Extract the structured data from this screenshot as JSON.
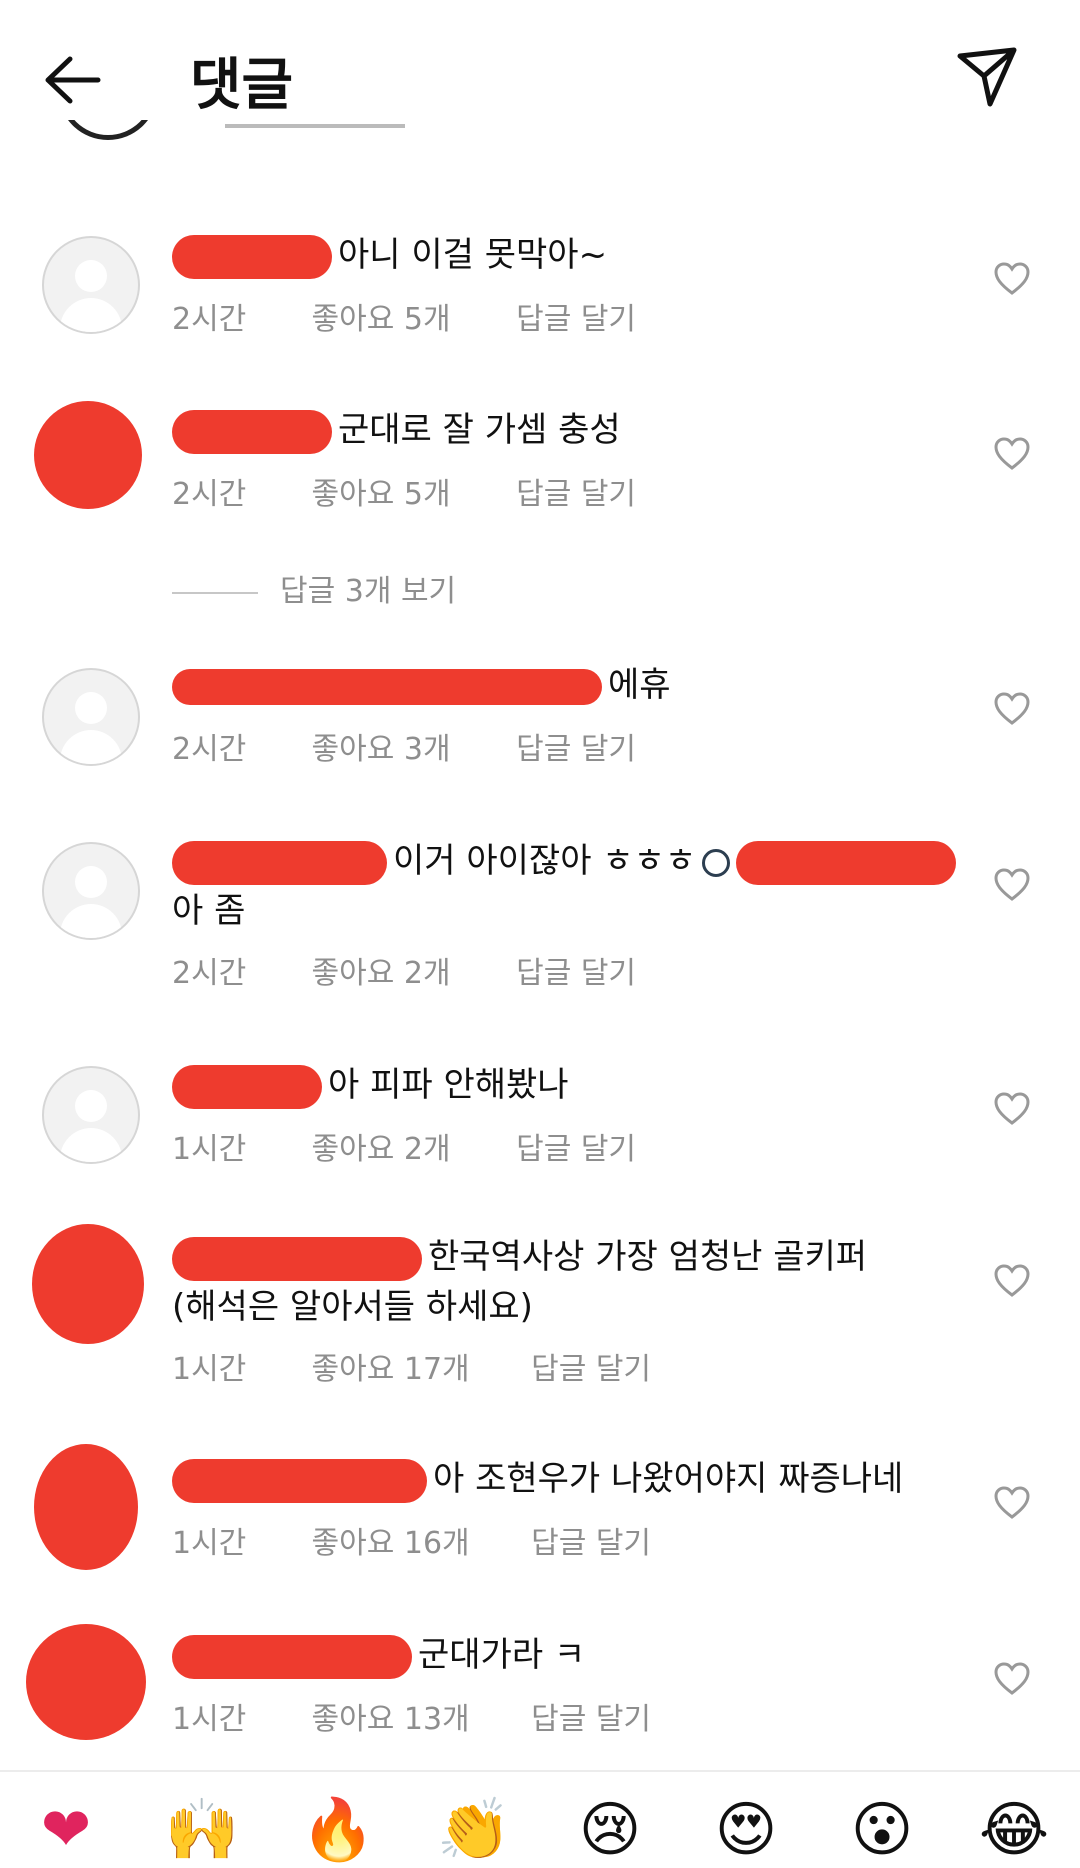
{
  "header": {
    "title": "댓글",
    "back_icon": "arrow-left-icon",
    "share_icon": "paper-plane-icon"
  },
  "comments": [
    {
      "text": "아니 이걸 못막아~",
      "time": "2시간",
      "likes": "좋아요 5개",
      "reply": "답글 달기"
    },
    {
      "text": "군대로 잘 가셈 충성",
      "time": "2시간",
      "likes": "좋아요 5개",
      "reply": "답글 달기"
    },
    {
      "text": "에휴",
      "time": "2시간",
      "likes": "좋아요 3개",
      "reply": "답글 달기"
    },
    {
      "text": "이거 아이잖아 ㅎㅎㅎ",
      "text2": "아 좀",
      "time": "2시간",
      "likes": "좋아요 2개",
      "reply": "답글 달기"
    },
    {
      "text": "아 피파 안해봤나",
      "time": "1시간",
      "likes": "좋아요 2개",
      "reply": "답글 달기"
    },
    {
      "text": "한국역사상 가장 엄청난 골키퍼",
      "text2": "(해석은 알아서들 하세요)",
      "time": "1시간",
      "likes": "좋아요 17개",
      "reply": "답글 달기"
    },
    {
      "text": "아 조현우가 나왔어야지 짜증나네",
      "time": "1시간",
      "likes": "좋아요 16개",
      "reply": "답글 달기"
    },
    {
      "text": "군대가라 ㅋ",
      "time": "1시간",
      "likes": "좋아요 13개",
      "reply": "답글 달기"
    }
  ],
  "view_replies": "답글 3개 보기",
  "emoji_bar": [
    "❤",
    "🙌",
    "🔥",
    "👏",
    "😢",
    "😍",
    "😮",
    "😂"
  ],
  "colors": {
    "redaction": "#ee3b2e",
    "meta": "#8e8e8e"
  }
}
